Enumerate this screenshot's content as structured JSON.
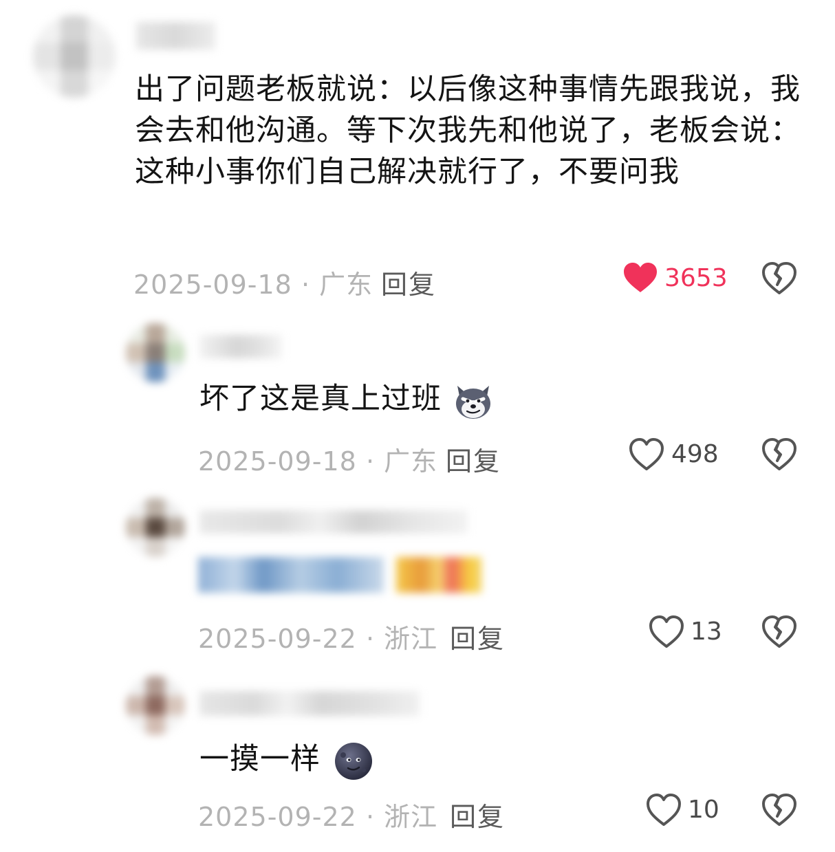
{
  "comments": [
    {
      "text": "出了问题老板就说：以后像这种事情先跟我说，我会去和他沟通。等下次我先和他说了，老板会说：这种小事你们自己解决就行了，不要问我",
      "date": "2025-09-18",
      "dot": "·",
      "location": "广东",
      "reply_label": "回复",
      "likes": "3653",
      "liked": true,
      "like_color": "#f0325a"
    },
    {
      "text": "坏了这是真上过班",
      "emoji": "wolf-face-emoji",
      "date": "2025-09-18",
      "dot": "·",
      "location": "广东",
      "reply_label": "回复",
      "likes": "498",
      "liked": false
    },
    {
      "text": "",
      "date": "2025-09-22",
      "dot": "·",
      "location": "浙江",
      "reply_label": "回复",
      "likes": "13",
      "liked": false
    },
    {
      "text": "一摸一样",
      "emoji": "new-moon-face-emoji",
      "date": "2025-09-22",
      "dot": "·",
      "location": "浙江",
      "reply_label": "回复",
      "likes": "10",
      "liked": false
    }
  ],
  "icons": {
    "like": "heart-icon",
    "dislike": "broken-heart-icon"
  }
}
